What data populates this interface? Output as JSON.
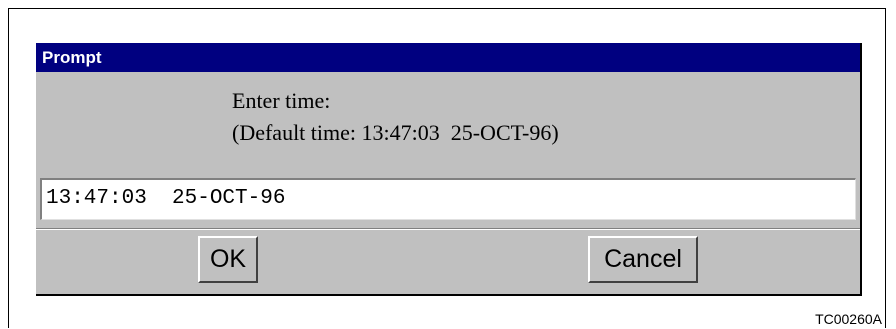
{
  "dialog": {
    "title": "Prompt",
    "message_line1": "Enter time:",
    "message_line2": "(Default time: 13:47:03  25-OCT-96)",
    "input_value": "13:47:03  25-OCT-96",
    "ok_label": "OK",
    "cancel_label": "Cancel"
  },
  "figure_code": "TC00260A",
  "colors": {
    "titlebar_bg": "#000080",
    "dialog_bg": "#c0c0c0"
  }
}
